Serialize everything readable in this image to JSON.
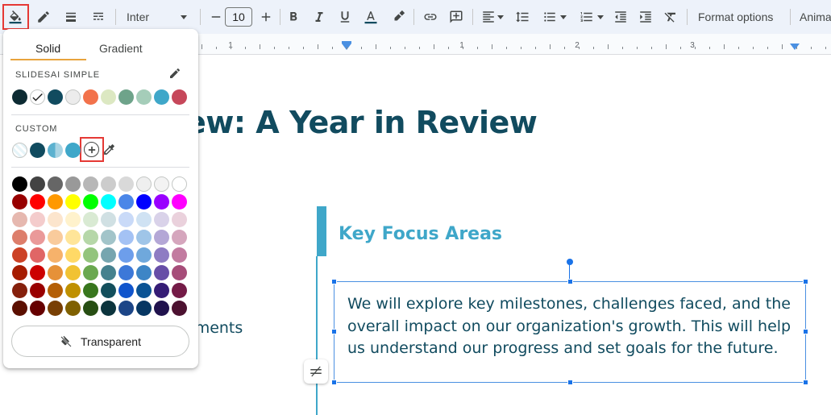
{
  "toolbar": {
    "font": "Inter",
    "font_size": "10",
    "format_options": "Format options",
    "animate": "Animat"
  },
  "ruler": {
    "labels": [
      "1",
      "1",
      "2",
      "3"
    ]
  },
  "slide": {
    "title": "ew: A Year in Review",
    "left_text": "ements",
    "focus_heading": "Key Focus Areas",
    "body": "We will explore key milestones, challenges faced, and the overall impact on our organization's growth. This will help us understand our progress and set goals for the future."
  },
  "color_picker": {
    "tabs": [
      "Solid",
      "Gradient"
    ],
    "active_tab": "Solid",
    "theme_label": "SLIDESAI SIMPLE",
    "custom_label": "CUSTOM",
    "transparent_label": "Transparent",
    "theme_colors": [
      "#0d2b33",
      "#ffffff",
      "#114b5f",
      "#ececec",
      "#f2724b",
      "#dce8c2",
      "#6ea38a",
      "#a5cdb9",
      "#3fa7c9",
      "#c6475a"
    ],
    "selected_theme_index": 1,
    "custom_colors": [
      "#e6f4f8",
      "#114b5f",
      "#5bb1cf",
      "#3fa7c9"
    ],
    "palette": [
      [
        "#000000",
        "#434343",
        "#666666",
        "#999999",
        "#b7b7b7",
        "#cccccc",
        "#d9d9d9",
        "#efefef",
        "#f3f3f3",
        "#ffffff"
      ],
      [
        "#980000",
        "#ff0000",
        "#ff9900",
        "#ffff00",
        "#00ff00",
        "#00ffff",
        "#4a86e8",
        "#0000ff",
        "#9900ff",
        "#ff00ff"
      ],
      [
        "#e6b8af",
        "#f4cccc",
        "#fce5cd",
        "#fff2cc",
        "#d9ead3",
        "#d0e0e3",
        "#c9daf8",
        "#cfe2f3",
        "#d9d2e9",
        "#ead1dc"
      ],
      [
        "#dd7e6b",
        "#ea9999",
        "#f9cb9c",
        "#ffe599",
        "#b6d7a8",
        "#a2c4c9",
        "#a4c2f4",
        "#9fc5e8",
        "#b4a7d6",
        "#d5a6bd"
      ],
      [
        "#cc4125",
        "#e06666",
        "#f6b26b",
        "#ffd966",
        "#93c47d",
        "#76a5af",
        "#6d9eeb",
        "#6fa8dc",
        "#8e7cc3",
        "#c27ba0"
      ],
      [
        "#a61c00",
        "#cc0000",
        "#e69138",
        "#f1c232",
        "#6aa84f",
        "#45818e",
        "#3c78d8",
        "#3d85c6",
        "#674ea7",
        "#a64d79"
      ],
      [
        "#85200c",
        "#990000",
        "#b45f06",
        "#bf9000",
        "#38761d",
        "#134f5c",
        "#1155cc",
        "#0b5394",
        "#351c75",
        "#741b47"
      ],
      [
        "#5b0f00",
        "#660000",
        "#783f04",
        "#7f6000",
        "#274e13",
        "#0c343d",
        "#1c4587",
        "#073763",
        "#20124d",
        "#4c1130"
      ]
    ]
  }
}
